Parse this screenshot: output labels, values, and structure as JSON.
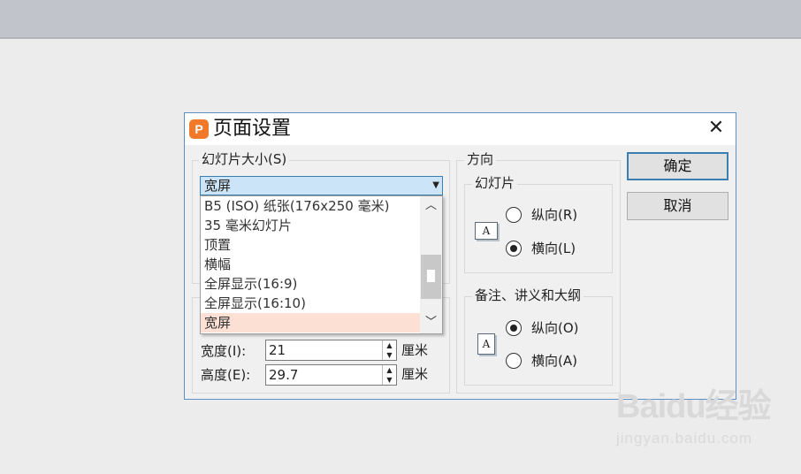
{
  "dialog": {
    "title": "页面设置",
    "app_icon_glyph": "P",
    "close_glyph": "✕"
  },
  "slide_size": {
    "legend": "幻灯片大小(S)",
    "selected": "宽屏",
    "options": [
      "B5 (ISO) 纸张(176x250 毫米)",
      "35 毫米幻灯片",
      "顶置",
      "横幅",
      "全屏显示(16:9)",
      "全屏显示(16:10)",
      "宽屏"
    ]
  },
  "dimensions": {
    "width_label": "宽度(I):",
    "width_value": "21",
    "height_label": "高度(E):",
    "height_value": "29.7",
    "unit": "厘米"
  },
  "orientation": {
    "legend": "方向",
    "slides": {
      "legend": "幻灯片",
      "portrait_label": "纵向(R)",
      "landscape_label": "横向(L)",
      "selected": "landscape"
    },
    "notes": {
      "legend": "备注、讲义和大纲",
      "portrait_label": "纵向(O)",
      "landscape_label": "横向(A)",
      "selected": "portrait"
    },
    "page_icon_glyph": "A"
  },
  "buttons": {
    "ok": "确定",
    "cancel": "取消"
  },
  "watermark": {
    "logo": "Baidu经验",
    "url": "jingyan.baidu.com"
  },
  "colors": {
    "titlebar_border": "#5a8fc8",
    "select_highlight": "#cce4f7",
    "list_selected": "#fde0d4",
    "app_icon": "#f07a2a"
  },
  "icons": {
    "app": "wps-presentation-icon",
    "close": "close-icon",
    "dropdown": "chevron-down-icon",
    "scroll_up": "chevron-up-icon",
    "scroll_down": "chevron-down-icon"
  }
}
